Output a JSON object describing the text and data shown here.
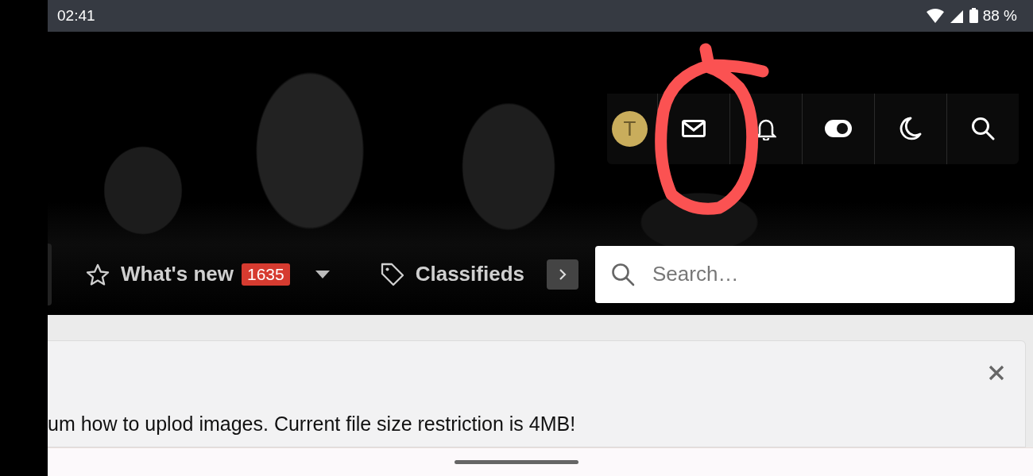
{
  "status_bar": {
    "time": "02:41",
    "battery": "88 %"
  },
  "header": {
    "avatar": "T"
  },
  "nav": {
    "items": [
      {
        "label": "What's new",
        "badge": "1635"
      },
      {
        "label": "Classifieds"
      }
    ]
  },
  "search": {
    "placeholder": "Search…"
  },
  "notice": {
    "text": "um how to uplod images. Current file size restriction is 4MB!"
  }
}
